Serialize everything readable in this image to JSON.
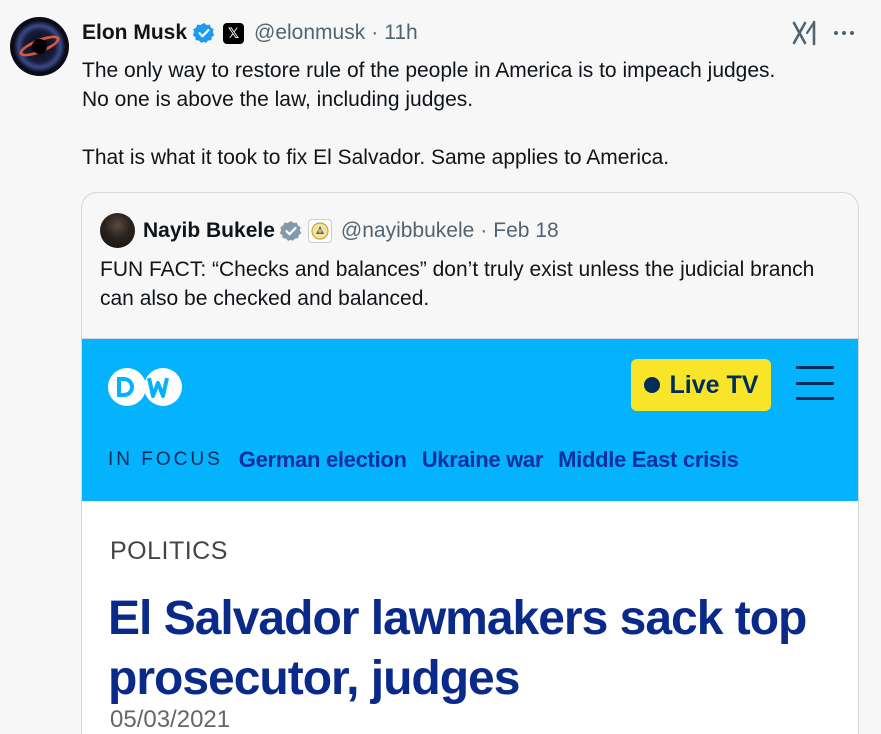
{
  "tweet": {
    "author_name": "Elon Musk",
    "handle": "@elonmusk",
    "separator": "·",
    "time": "11h",
    "lines": [
      "The only way to restore rule of the people in America is to impeach judges.",
      "No one is above the law, including judges.",
      "",
      "That is what it took to fix El Salvador. Same applies to America."
    ]
  },
  "quote": {
    "author_name": "Nayib Bukele",
    "handle": "@nayibbukele",
    "separator": "·",
    "time": "Feb 18",
    "text": "FUN FACT: “Checks and balances” don’t truly exist unless the judicial branch can also be checked and balanced."
  },
  "dw": {
    "logo_text": "DW",
    "live_label": "Live TV",
    "in_focus_label": "IN FOCUS",
    "focus_links": [
      "German election",
      "Ukraine war",
      "Middle East crisis"
    ],
    "kicker": "POLITICS",
    "headline": "El Salvador lawmakers sack top prosecutor, judges",
    "date": "05/03/2021"
  },
  "colors": {
    "verified_blue": "#1d9bf0",
    "dw_blue": "#05b2fc",
    "live_yellow": "#f8e52a",
    "headline_blue": "#0a2a8a"
  },
  "icons": {
    "verified": "verified-check-icon",
    "x_badge": "x-logo-icon",
    "grok": "grok-icon",
    "more": "more-dots-icon",
    "menu": "hamburger-menu-icon"
  }
}
